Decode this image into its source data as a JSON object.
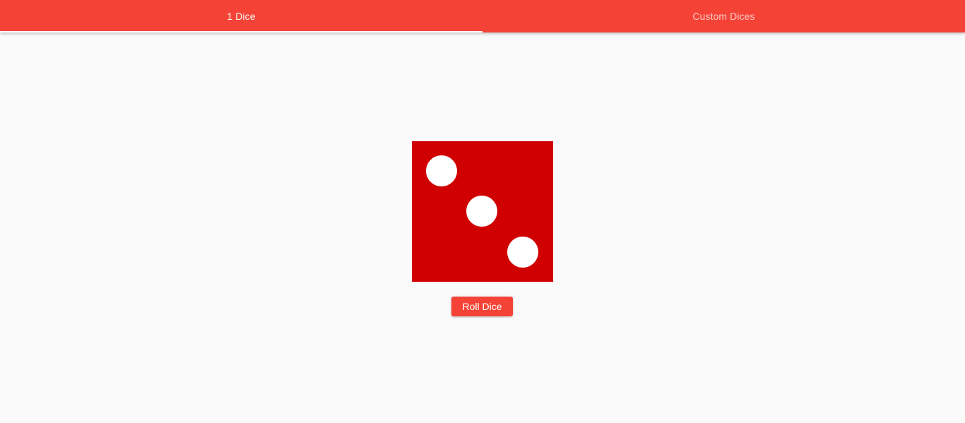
{
  "tabs": [
    {
      "label": "1 Dice",
      "active": true
    },
    {
      "label": "Custom Dices",
      "active": false
    }
  ],
  "dice": {
    "value": 3,
    "face_icon": "dice-three-icon",
    "face_color": "#d10000",
    "pip_color": "#ffffff"
  },
  "roll_button": {
    "label": "Roll Dice"
  },
  "colors": {
    "accent": "#f44336",
    "background": "#fafafa"
  }
}
